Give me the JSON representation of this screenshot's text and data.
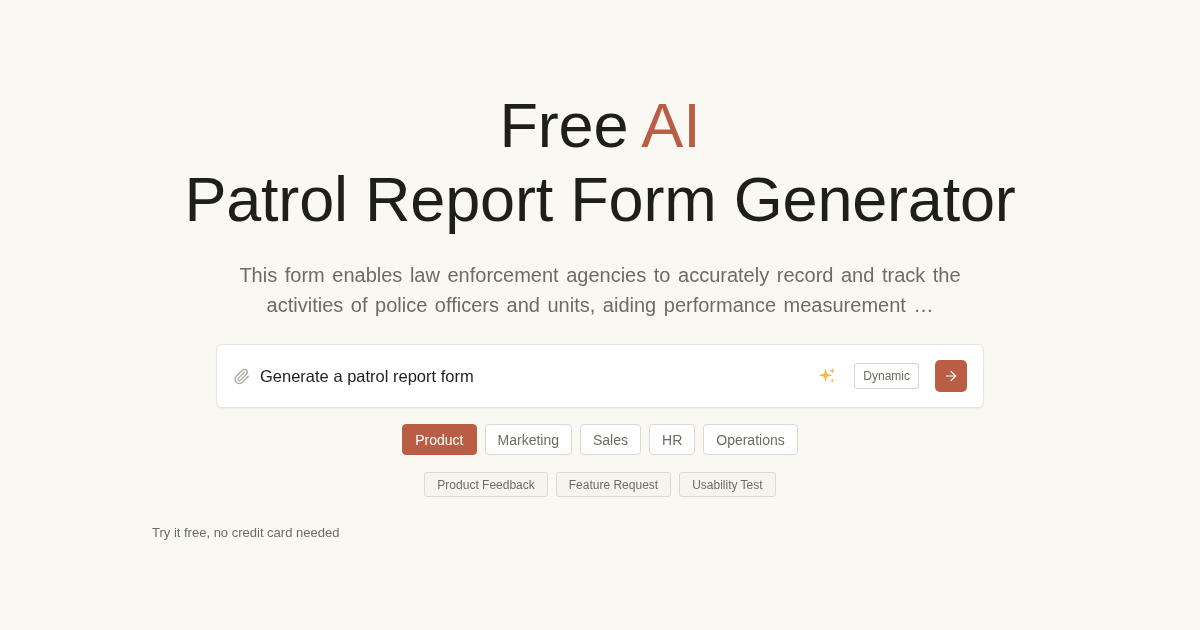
{
  "hero": {
    "title_start": "Free",
    "title_accent": "AI",
    "title_end": "Patrol Report Form Generator",
    "description": "This form enables law enforcement agencies to accurately record and track the activities of police officers and units, aiding performance measurement …"
  },
  "prompt": {
    "value": "Generate a patrol report form",
    "mode_button": "Dynamic"
  },
  "categories": [
    {
      "label": "Product",
      "selected": true
    },
    {
      "label": "Marketing",
      "selected": false
    },
    {
      "label": "Sales",
      "selected": false
    },
    {
      "label": "HR",
      "selected": false
    },
    {
      "label": "Operations",
      "selected": false
    }
  ],
  "templates": [
    "Product Feedback",
    "Feature Request",
    "Usability Test"
  ],
  "footnote": "Try it free, no credit card needed"
}
